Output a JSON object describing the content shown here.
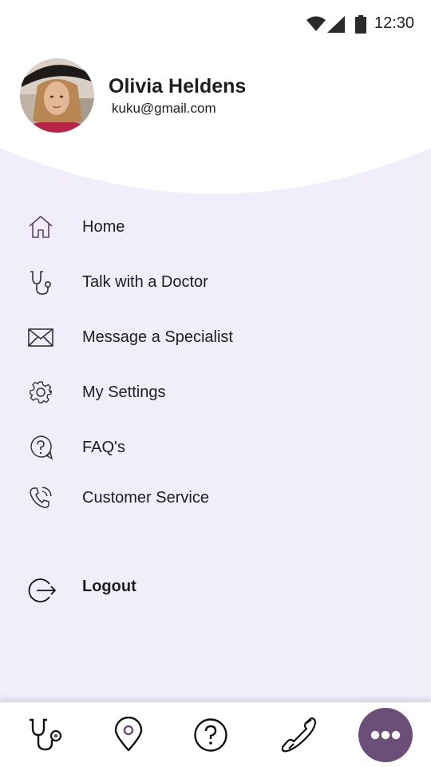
{
  "status_bar": {
    "time": "12:30",
    "icons": [
      "wifi-icon",
      "signal-icon",
      "battery-icon"
    ]
  },
  "profile": {
    "name": "Olivia Heldens",
    "email": "kuku@gmail.com"
  },
  "menu": {
    "items": [
      {
        "label": "Home",
        "icon": "home-icon"
      },
      {
        "label": "Talk with a Doctor",
        "icon": "stethoscope-icon"
      },
      {
        "label": "Message a Specialist",
        "icon": "envelope-icon"
      },
      {
        "label": "My Settings",
        "icon": "gear-icon"
      },
      {
        "label": "FAQ's",
        "icon": "question-bubble-icon"
      },
      {
        "label": "Customer Service",
        "icon": "phone-call-icon"
      }
    ],
    "logout_label": "Logout"
  },
  "bottom_nav": {
    "items": [
      "stethoscope-icon",
      "location-pin-icon",
      "help-circle-icon",
      "phone-icon",
      "more-icon"
    ]
  },
  "colors": {
    "accent": "#6b4f78",
    "background": "#f1edfb",
    "header": "#ffffff"
  }
}
